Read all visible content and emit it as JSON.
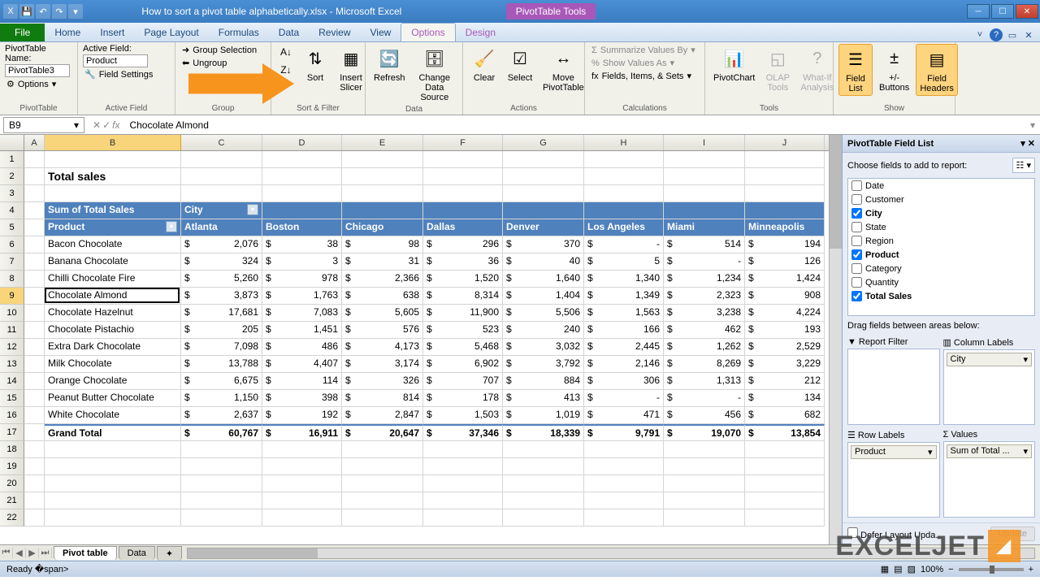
{
  "title": "How to sort a pivot table alphabetically.xlsx - Microsoft Excel",
  "tools_tab": "PivotTable Tools",
  "tabs": {
    "file": "File",
    "home": "Home",
    "insert": "Insert",
    "pagelayout": "Page Layout",
    "formulas": "Formulas",
    "data": "Data",
    "review": "Review",
    "view": "View",
    "options": "Options",
    "design": "Design"
  },
  "ribbon": {
    "pivottable": {
      "namelbl": "PivotTable Name:",
      "name": "PivotTable3",
      "options": "Options",
      "glabel": "PivotTable"
    },
    "activefield": {
      "lbl": "Active Field:",
      "field": "Product",
      "settings": "Field Settings",
      "glabel": "Active Field"
    },
    "group": {
      "sel": "Group Selection",
      "ungroup": "Ungroup",
      "glabel": "Group"
    },
    "sortfilter": {
      "sort": "Sort",
      "slicer": "Insert\nSlicer",
      "glabel": "Sort & Filter"
    },
    "data": {
      "refresh": "Refresh",
      "cds": "Change Data\nSource",
      "glabel": "Data"
    },
    "actions": {
      "clear": "Clear",
      "select": "Select",
      "move": "Move\nPivotTable",
      "glabel": "Actions"
    },
    "calc": {
      "summarize": "Summarize Values By",
      "showas": "Show Values As",
      "fields": "Fields, Items, & Sets",
      "glabel": "Calculations"
    },
    "tools": {
      "chart": "PivotChart",
      "olap": "OLAP\nTools",
      "whatif": "What-If\nAnalysis",
      "glabel": "Tools"
    },
    "show": {
      "fl": "Field\nList",
      "btns": "+/-\nButtons",
      "fh": "Field\nHeaders",
      "glabel": "Show"
    }
  },
  "namebox": "B9",
  "formula": "Chocolate Almond",
  "colheaders": [
    "A",
    "B",
    "C",
    "D",
    "E",
    "F",
    "G",
    "H",
    "I",
    "J"
  ],
  "rowheaders": [
    "1",
    "2",
    "3",
    "4",
    "5",
    "6",
    "7",
    "8",
    "9",
    "10",
    "11",
    "12",
    "13",
    "14",
    "15",
    "16",
    "17",
    "18",
    "19",
    "20",
    "21",
    "22"
  ],
  "title_cell": "Total sales",
  "pivot": {
    "sumlabel": "Sum of Total Sales",
    "citylabel": "City",
    "productlabel": "Product",
    "cities": [
      "Atlanta",
      "Boston",
      "Chicago",
      "Dallas",
      "Denver",
      "Los Angeles",
      "Miami",
      "Minneapolis"
    ],
    "rows": [
      {
        "p": "Bacon Chocolate",
        "v": [
          "2,076",
          "38",
          "98",
          "296",
          "370",
          "-",
          "514",
          "194"
        ]
      },
      {
        "p": "Banana Chocolate",
        "v": [
          "324",
          "3",
          "31",
          "36",
          "40",
          "5",
          "-",
          "126"
        ]
      },
      {
        "p": "Chilli Chocolate Fire",
        "v": [
          "5,260",
          "978",
          "2,366",
          "1,520",
          "1,640",
          "1,340",
          "1,234",
          "1,424"
        ]
      },
      {
        "p": "Chocolate Almond",
        "v": [
          "3,873",
          "1,763",
          "638",
          "8,314",
          "1,404",
          "1,349",
          "2,323",
          "908"
        ]
      },
      {
        "p": "Chocolate Hazelnut",
        "v": [
          "17,681",
          "7,083",
          "5,605",
          "11,900",
          "5,506",
          "1,563",
          "3,238",
          "4,224"
        ]
      },
      {
        "p": "Chocolate Pistachio",
        "v": [
          "205",
          "1,451",
          "576",
          "523",
          "240",
          "166",
          "462",
          "193"
        ]
      },
      {
        "p": "Extra Dark Chocolate",
        "v": [
          "7,098",
          "486",
          "4,173",
          "5,468",
          "3,032",
          "2,445",
          "1,262",
          "2,529"
        ]
      },
      {
        "p": "Milk Chocolate",
        "v": [
          "13,788",
          "4,407",
          "3,174",
          "6,902",
          "3,792",
          "2,146",
          "8,269",
          "3,229"
        ]
      },
      {
        "p": "Orange Chocolate",
        "v": [
          "6,675",
          "114",
          "326",
          "707",
          "884",
          "306",
          "1,313",
          "212"
        ]
      },
      {
        "p": "Peanut Butter Chocolate",
        "v": [
          "1,150",
          "398",
          "814",
          "178",
          "413",
          "-",
          "-",
          "134"
        ]
      },
      {
        "p": "White Chocolate",
        "v": [
          "2,637",
          "192",
          "2,847",
          "1,503",
          "1,019",
          "471",
          "456",
          "682"
        ]
      }
    ],
    "totallabel": "Grand Total",
    "totals": [
      "60,767",
      "16,911",
      "20,647",
      "37,346",
      "18,339",
      "9,791",
      "19,070",
      "13,854"
    ]
  },
  "fieldlist": {
    "title": "PivotTable Field List",
    "choose": "Choose fields to add to report:",
    "fields": [
      {
        "n": "Date",
        "c": false
      },
      {
        "n": "Customer",
        "c": false
      },
      {
        "n": "City",
        "c": true
      },
      {
        "n": "State",
        "c": false
      },
      {
        "n": "Region",
        "c": false
      },
      {
        "n": "Product",
        "c": true
      },
      {
        "n": "Category",
        "c": false
      },
      {
        "n": "Quantity",
        "c": false
      },
      {
        "n": "Total Sales",
        "c": true
      }
    ],
    "dragtxt": "Drag fields between areas below:",
    "areas": {
      "report": "Report Filter",
      "column": "Column Labels",
      "row": "Row Labels",
      "values": "Values",
      "colitem": "City",
      "rowitem": "Product",
      "valitem": "Sum of Total ..."
    },
    "defer": "Defer Layout Upda...",
    "update": "Update"
  },
  "sheettabs": {
    "pivot": "Pivot table",
    "data": "Data"
  },
  "status": {
    "ready": "Ready",
    "zoom": "100%"
  },
  "watermark": "EXCELJET"
}
